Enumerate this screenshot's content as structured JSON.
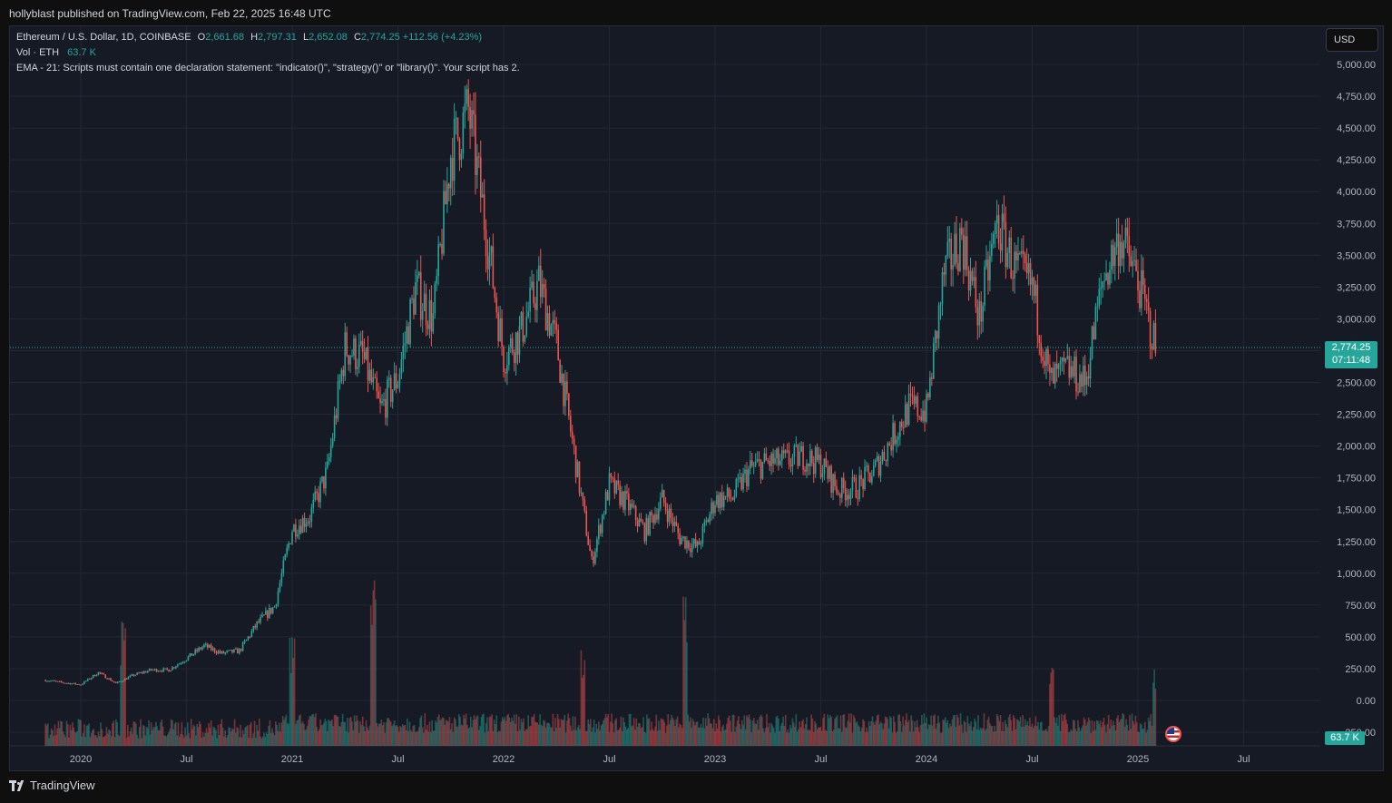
{
  "header": {
    "publisher_line": "hollyblast published on TradingView.com, Feb 22, 2025 16:48 UTC"
  },
  "legend": {
    "symbol": "Ethereum / U.S. Dollar, 1D, COINBASE",
    "open_label": "O",
    "open": "2,661.68",
    "high_label": "H",
    "high": "2,797.31",
    "low_label": "L",
    "low": "2,652.08",
    "close_label": "C",
    "close": "2,774.25",
    "change": "+112.56 (+4.23%)",
    "vol_label": "Vol · ETH",
    "vol_value": "63.7 K",
    "ema_error": "EMA - 21: Scripts must contain one declaration statement: \"indicator()\", \"strategy()\" or \"library()\". Your script has 2."
  },
  "currency_button": "USD",
  "price_tag": {
    "price": "2,774.25",
    "countdown": "07:11:48"
  },
  "volume_tag": "63.7 K",
  "branding": "TradingView",
  "colors": {
    "up": "#26a69a",
    "down": "#ef5350",
    "background": "#161a25",
    "grid": "#232734",
    "text": "#b2b5be"
  },
  "chart_data": {
    "type": "candlestick",
    "interval": "1D",
    "symbol": "ETH/USD",
    "current_price": 2774.25,
    "y_axis": {
      "ticks": [
        "5,000.00",
        "4,750.00",
        "4,500.00",
        "4,250.00",
        "4,000.00",
        "3,750.00",
        "3,500.00",
        "3,250.00",
        "3,000.00",
        "2,750.00",
        "2,500.00",
        "2,250.00",
        "2,000.00",
        "1,750.00",
        "1,500.00",
        "1,250.00",
        "1,000.00",
        "750.00",
        "500.00",
        "250.00",
        "0.00",
        "-250.00"
      ],
      "ylim": [
        -250,
        5000
      ],
      "scale": "linear"
    },
    "x_axis": {
      "ticks": [
        "2020",
        "Jul",
        "2021",
        "Jul",
        "2022",
        "Jul",
        "2023",
        "Jul",
        "2024",
        "Jul",
        "2025",
        "Jul"
      ]
    },
    "grid": true,
    "series": [
      {
        "name": "close (approx. monthly)",
        "x": [
          "2019-11",
          "2019-12",
          "2020-01",
          "2020-02",
          "2020-03",
          "2020-04",
          "2020-05",
          "2020-06",
          "2020-07",
          "2020-08",
          "2020-09",
          "2020-10",
          "2020-11",
          "2020-12",
          "2021-01",
          "2021-02",
          "2021-03",
          "2021-04",
          "2021-05",
          "2021-06",
          "2021-07",
          "2021-08",
          "2021-09",
          "2021-10",
          "2021-11",
          "2021-12",
          "2022-01",
          "2022-02",
          "2022-03",
          "2022-04",
          "2022-05",
          "2022-06",
          "2022-07",
          "2022-08",
          "2022-09",
          "2022-10",
          "2022-11",
          "2022-12",
          "2023-01",
          "2023-02",
          "2023-03",
          "2023-04",
          "2023-05",
          "2023-06",
          "2023-07",
          "2023-08",
          "2023-09",
          "2023-10",
          "2023-11",
          "2023-12",
          "2024-01",
          "2024-02",
          "2024-03",
          "2024-04",
          "2024-05",
          "2024-06",
          "2024-07",
          "2024-08",
          "2024-09",
          "2024-10",
          "2024-11",
          "2024-12",
          "2025-01",
          "2025-02"
        ],
        "values": [
          160,
          140,
          125,
          220,
          135,
          200,
          240,
          240,
          330,
          430,
          370,
          390,
          600,
          740,
          1350,
          1450,
          1800,
          2770,
          2700,
          2280,
          2540,
          3240,
          3000,
          4300,
          4640,
          3700,
          2700,
          2900,
          3280,
          2800,
          1950,
          1080,
          1700,
          1550,
          1330,
          1580,
          1280,
          1200,
          1580,
          1600,
          1820,
          1870,
          1880,
          1920,
          1860,
          1650,
          1670,
          1800,
          2050,
          2300,
          2280,
          3350,
          3650,
          3000,
          3750,
          3400,
          3250,
          2500,
          2600,
          2500,
          3300,
          3650,
          3300,
          2774.25
        ]
      },
      {
        "name": "volume",
        "note": "daily volume histogram along bottom; peaks around Mar 2020, May 2021, Nov 2022, Aug 2024, Feb 2025"
      }
    ]
  }
}
